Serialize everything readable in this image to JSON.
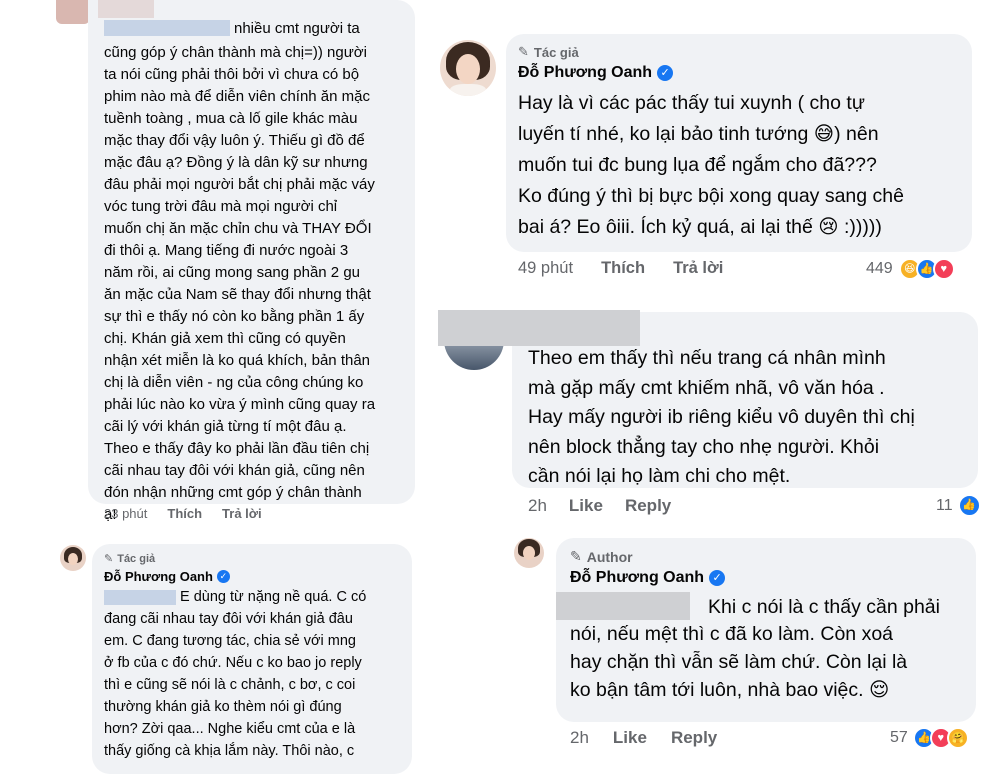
{
  "c1": {
    "name_suffix": "nhiều cmt người ta",
    "body": "cũng góp ý chân thành mà chị=)) người\nta nói cũng phải thôi bởi vì chưa có bộ\nphim nào mà để diễn viên chính ăn mặc\ntuềnh toàng , mua cà lố gile khác màu\nmặc thay đổi vậy luôn ý. Thiếu gì đồ để\nmặc đâu ạ? Đồng ý là dân kỹ sư nhưng\nđâu phải mọi người bắt chị phải mặc váy\nvóc tung trời đâu mà mọi người chỉ\nmuốn chị ăn mặc chỉn chu và THAY ĐỔI\nđi thôi ạ. Mang tiếng đi nước ngoài 3\nnăm rồi, ai cũng mong sang phần 2 gu\năn mặc của Nam sẽ thay đổi nhưng thật\nsự thì e thấy nó còn ko bằng phần 1 ấy\nchị. Khán giả xem thì cũng có quyền\nnhận xét miễn là ko quá khích, bản thân\nchị là diễn viên - ng của công chúng ko\nphải lúc nào ko vừa ý mình cũng quay ra\ncãi lý với khán giả từng tí một đâu ạ.\nTheo e thấy đây ko phải lần đầu tiên chị\ncãi nhau tay đôi với khán giả, cũng nên\nđón nhận những cmt góp ý chân thành\nạ!",
    "time": "23 phút",
    "like": "Thích",
    "reply": "Trả lời"
  },
  "c2": {
    "author_label": "Tác giả",
    "name": "Đỗ Phương Oanh",
    "body": "E dùng từ nặng nề quá. C có\nđang cãi nhau tay đôi với khán giả đâu\nem. C đang tương tác, chia sẻ với mng\nở fb của c đó chứ. Nếu c ko bao jo reply\nthì e cũng sẽ nói là c chảnh, c bơ, c coi\nthường khán giả ko thèm nói gì đúng\nhơn? Zời qaa... Nghe kiểu cmt của e là\nthấy giống cà khịa lắm này. Thôi nào, c"
  },
  "c3": {
    "author_label": "Tác giả",
    "name": "Đỗ Phương Oanh",
    "body": "Hay là vì các pác thấy tui xuynh ( cho tự\nluyến tí nhé, ko lại bảo tinh tướng 😅) nên\nmuốn tui đc bung lụa để ngắm cho đã???\nKo đúng ý thì bị bực bội xong quay sang chê\nbai á? Eo ôiii. Ích kỷ quá, ai lại thế 😢 :)))))",
    "time": "49 phút",
    "like": "Thích",
    "reply": "Trả lời",
    "reaction_count": "449"
  },
  "c4": {
    "body": "Theo em thấy thì nếu trang cá nhân mình\nmà gặp mấy cmt khiếm nhã, vô văn hóa .\nHay mấy người ib riêng kiểu vô duyên thì chị\nnên block thẳng tay cho nhẹ người. Khỏi\ncần nói lại họ làm chi cho mệt.",
    "time": "2h",
    "like": "Like",
    "reply": "Reply",
    "reaction_count": "11"
  },
  "c5": {
    "author_label": "Author",
    "name": "Đỗ Phương Oanh",
    "first_line": "Khi c nói là c thấy cần phải",
    "body": "nói, nếu mệt thì c đã ko làm. Còn xoá\nhay chặn thì vẫn sẽ làm chứ. Còn lại là\nko bận tâm tới luôn, nhà bao việc. 😌",
    "time": "2h",
    "like": "Like",
    "reply": "Reply",
    "reaction_count": "57"
  },
  "colors": {
    "bubble": "#f0f2f5",
    "meta": "#65676b",
    "verified": "#1877f2",
    "like_blue": "#1877f2",
    "love_red": "#f33e58",
    "haha_yellow": "#f7b125"
  }
}
